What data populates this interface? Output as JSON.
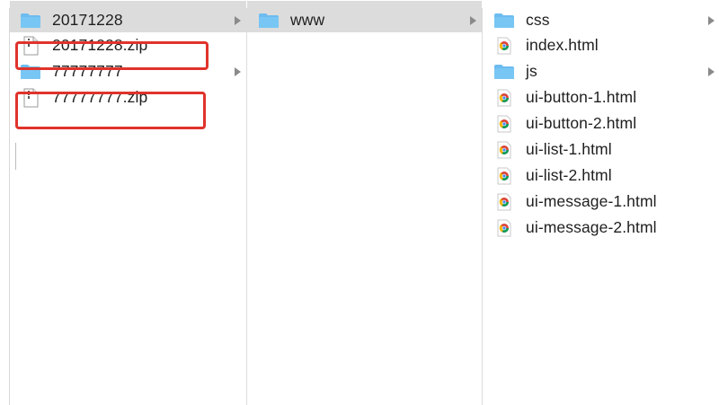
{
  "columns": [
    {
      "items": [
        {
          "label": "20171228",
          "type": "folder",
          "has_children": true,
          "selected": true,
          "highlighted": false
        },
        {
          "label": "20171228.zip",
          "type": "zip",
          "has_children": false,
          "selected": false,
          "highlighted": true
        },
        {
          "label": "77777777",
          "type": "folder",
          "has_children": true,
          "selected": false,
          "highlighted": false
        },
        {
          "label": "77777777.zip",
          "type": "zip",
          "has_children": false,
          "selected": false,
          "highlighted": true
        }
      ]
    },
    {
      "items": [
        {
          "label": "www",
          "type": "folder",
          "has_children": true,
          "selected": true,
          "highlighted": false
        }
      ]
    },
    {
      "items": [
        {
          "label": "css",
          "type": "folder",
          "has_children": true,
          "selected": false
        },
        {
          "label": "index.html",
          "type": "html",
          "has_children": false,
          "selected": false
        },
        {
          "label": "js",
          "type": "folder",
          "has_children": true,
          "selected": false
        },
        {
          "label": "ui-button-1.html",
          "type": "html",
          "has_children": false,
          "selected": false
        },
        {
          "label": "ui-button-2.html",
          "type": "html",
          "has_children": false,
          "selected": false
        },
        {
          "label": "ui-list-1.html",
          "type": "html",
          "has_children": false,
          "selected": false
        },
        {
          "label": "ui-list-2.html",
          "type": "html",
          "has_children": false,
          "selected": false
        },
        {
          "label": "ui-message-1.html",
          "type": "html",
          "has_children": false,
          "selected": false
        },
        {
          "label": "ui-message-2.html",
          "type": "html",
          "has_children": false,
          "selected": false
        }
      ]
    }
  ],
  "colors": {
    "folder": "#6cbcf0",
    "folder_tab": "#5aaee6",
    "selection": "#dcdcdc",
    "highlight_border": "#e0332b",
    "chevron": "#8a8a8a"
  },
  "icons": {
    "folder": "folder-icon",
    "zip": "zip-file-icon",
    "html": "chrome-html-icon",
    "disclosure": "chevron-right-icon"
  }
}
